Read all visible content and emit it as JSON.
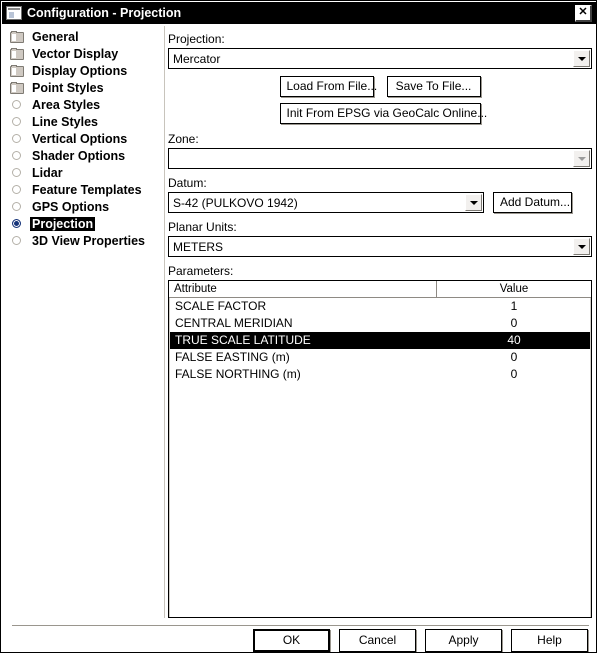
{
  "window": {
    "title": "Configuration - Projection",
    "icon": "window-app-icon",
    "close_label": "✕"
  },
  "sidebar": {
    "items": [
      {
        "label": "General",
        "icon": "folder-icon",
        "selected": false
      },
      {
        "label": "Vector Display",
        "icon": "folder-icon",
        "selected": false
      },
      {
        "label": "Display Options",
        "icon": "folder-icon",
        "selected": false
      },
      {
        "label": "Point Styles",
        "icon": "folder-icon",
        "selected": false
      },
      {
        "label": "Area Styles",
        "icon": "radio-icon",
        "selected": false
      },
      {
        "label": "Line Styles",
        "icon": "radio-icon",
        "selected": false
      },
      {
        "label": "Vertical Options",
        "icon": "radio-icon",
        "selected": false
      },
      {
        "label": "Shader Options",
        "icon": "radio-icon",
        "selected": false
      },
      {
        "label": "Lidar",
        "icon": "radio-icon",
        "selected": false
      },
      {
        "label": "Feature Templates",
        "icon": "radio-icon",
        "selected": false
      },
      {
        "label": "GPS Options",
        "icon": "radio-icon",
        "selected": false
      },
      {
        "label": "Projection",
        "icon": "radio-icon",
        "selected": true
      },
      {
        "label": "3D View Properties",
        "icon": "radio-icon",
        "selected": false
      }
    ]
  },
  "content": {
    "projection": {
      "label": "Projection:",
      "value": "Mercator",
      "arrow_enabled": true
    },
    "buttons": {
      "load_from_file": "Load From File...",
      "save_to_file": "Save To File...",
      "init_from_epsg": "Init From EPSG via GeoCalc Online..."
    },
    "zone": {
      "label": "Zone:",
      "value": "",
      "arrow_enabled": false
    },
    "datum": {
      "label": "Datum:",
      "value": "S-42 (PULKOVO 1942)",
      "arrow_enabled": true,
      "add_button": "Add Datum..."
    },
    "planar_units": {
      "label": "Planar Units:",
      "value": "METERS",
      "arrow_enabled": true
    },
    "parameters": {
      "label": "Parameters:",
      "columns": [
        "Attribute",
        "Value"
      ],
      "rows": [
        {
          "attribute": "SCALE FACTOR",
          "value": "1",
          "selected": false
        },
        {
          "attribute": "CENTRAL MERIDIAN",
          "value": "0",
          "selected": false
        },
        {
          "attribute": "TRUE SCALE LATITUDE",
          "value": "40",
          "selected": true
        },
        {
          "attribute": "FALSE EASTING (m)",
          "value": "0",
          "selected": false
        },
        {
          "attribute": "FALSE NORTHING (m)",
          "value": "0",
          "selected": false
        }
      ]
    }
  },
  "footer": {
    "ok": "OK",
    "cancel": "Cancel",
    "apply": "Apply",
    "help": "Help"
  },
  "colors": {
    "titlebar_bg": "#000000",
    "titlebar_fg": "#ffffff",
    "selection_bg": "#000000",
    "selection_fg": "#ffffff",
    "radio_on": "#16347a",
    "dialog_bg": "#ffffff"
  }
}
